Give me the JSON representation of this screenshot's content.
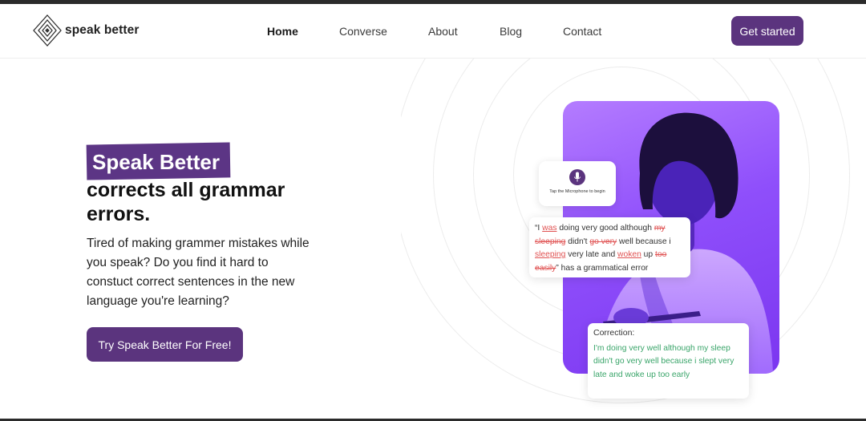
{
  "brand": {
    "name": "speak better"
  },
  "nav": {
    "items": [
      {
        "label": "Home",
        "active": true
      },
      {
        "label": "Converse"
      },
      {
        "label": "About"
      },
      {
        "label": "Blog"
      },
      {
        "label": "Contact"
      }
    ],
    "cta_label": "Get started"
  },
  "hero": {
    "highlight": "Speak Better",
    "headline": "corrects all grammar errors.",
    "description": "Tired of making grammer mistakes while you speak? Do you find it hard to constuct correct sentences in the new language you're learning?",
    "button_label": "Try Speak Better For Free!"
  },
  "mic_card": {
    "caption": "Tap the Microphone to begin",
    "icon": "microphone-icon"
  },
  "error_card": {
    "segments": [
      {
        "text": "“I ",
        "style": "normal"
      },
      {
        "text": "was",
        "style": "inserted"
      },
      {
        "text": " doing very good although ",
        "style": "normal"
      },
      {
        "text": "my sleeping",
        "style": "deleted"
      },
      {
        "text": " didn't ",
        "style": "normal"
      },
      {
        "text": "go very",
        "style": "deleted"
      },
      {
        "text": " well because i ",
        "style": "normal"
      },
      {
        "text": "sleeping",
        "style": "inserted"
      },
      {
        "text": " very late and ",
        "style": "normal"
      },
      {
        "text": "woken",
        "style": "inserted"
      },
      {
        "text": " up ",
        "style": "normal"
      },
      {
        "text": "too easily",
        "style": "deleted"
      },
      {
        "text": "” has a grammatical error",
        "style": "normal"
      }
    ]
  },
  "correction_card": {
    "title": "Correction:",
    "text": "I'm doing very well although my sleep didn't go very well because i slept very late and woke up too early"
  },
  "colors": {
    "brand_purple": "#5b347e",
    "error_red": "#e05252",
    "correction_green": "#3aa56a",
    "photo_purple": "#8f4ffb"
  }
}
